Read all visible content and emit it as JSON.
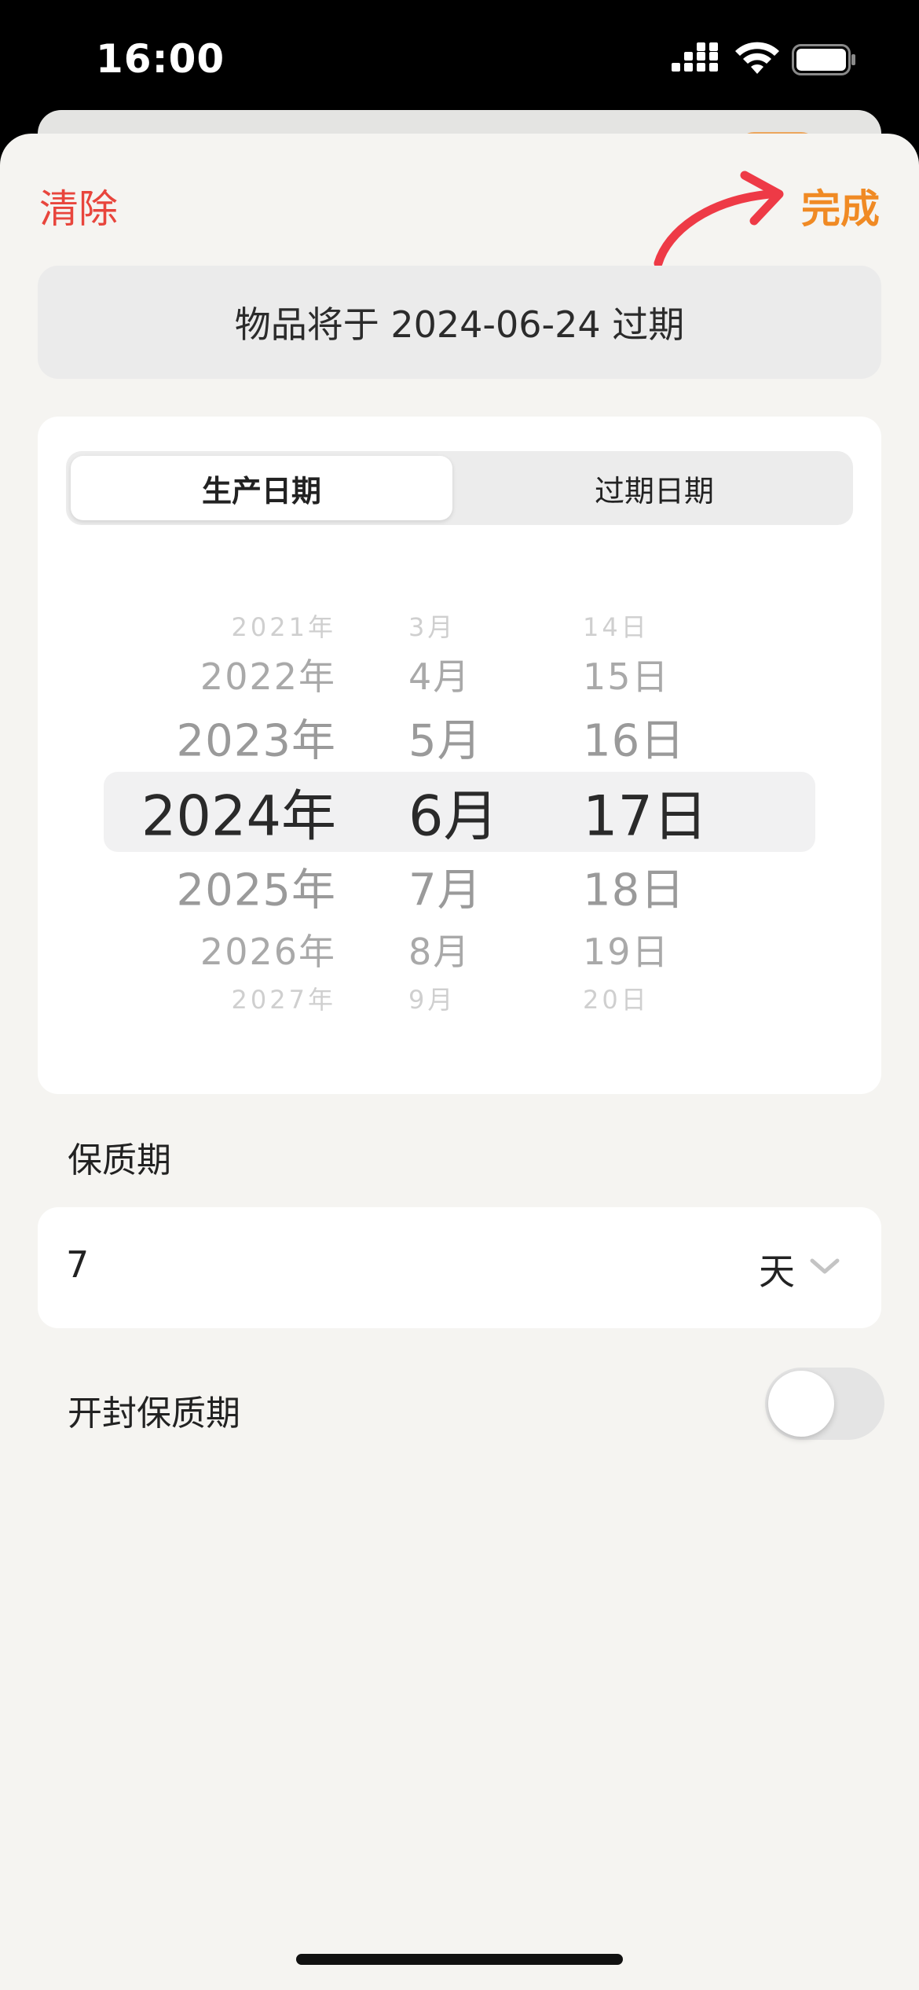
{
  "status_bar": {
    "time": "16:00"
  },
  "toolbar": {
    "clear_label": "清除",
    "done_label": "完成"
  },
  "expiry_banner": {
    "text": "物品将于 2024-06-24 过期"
  },
  "segmented": {
    "production_label": "生产日期",
    "expiry_label": "过期日期",
    "selected": "生产日期"
  },
  "picker": {
    "rows": [
      {
        "year": "2021年",
        "month": "3月",
        "day": "14日"
      },
      {
        "year": "2022年",
        "month": "4月",
        "day": "15日"
      },
      {
        "year": "2023年",
        "month": "5月",
        "day": "16日"
      },
      {
        "year": "2024年",
        "month": "6月",
        "day": "17日"
      },
      {
        "year": "2025年",
        "month": "7月",
        "day": "18日"
      },
      {
        "year": "2026年",
        "month": "8月",
        "day": "19日"
      },
      {
        "year": "2027年",
        "month": "9月",
        "day": "20日"
      }
    ],
    "selected": {
      "year": "2024年",
      "month": "6月",
      "day": "17日"
    }
  },
  "shelf_life": {
    "label": "保质期",
    "value": "7",
    "unit": "天"
  },
  "opened_shelf_life": {
    "label": "开封保质期",
    "enabled": false
  },
  "colors": {
    "accent": "#f08a24",
    "destructive": "#e8453c",
    "arrow": "#ee3a46"
  }
}
